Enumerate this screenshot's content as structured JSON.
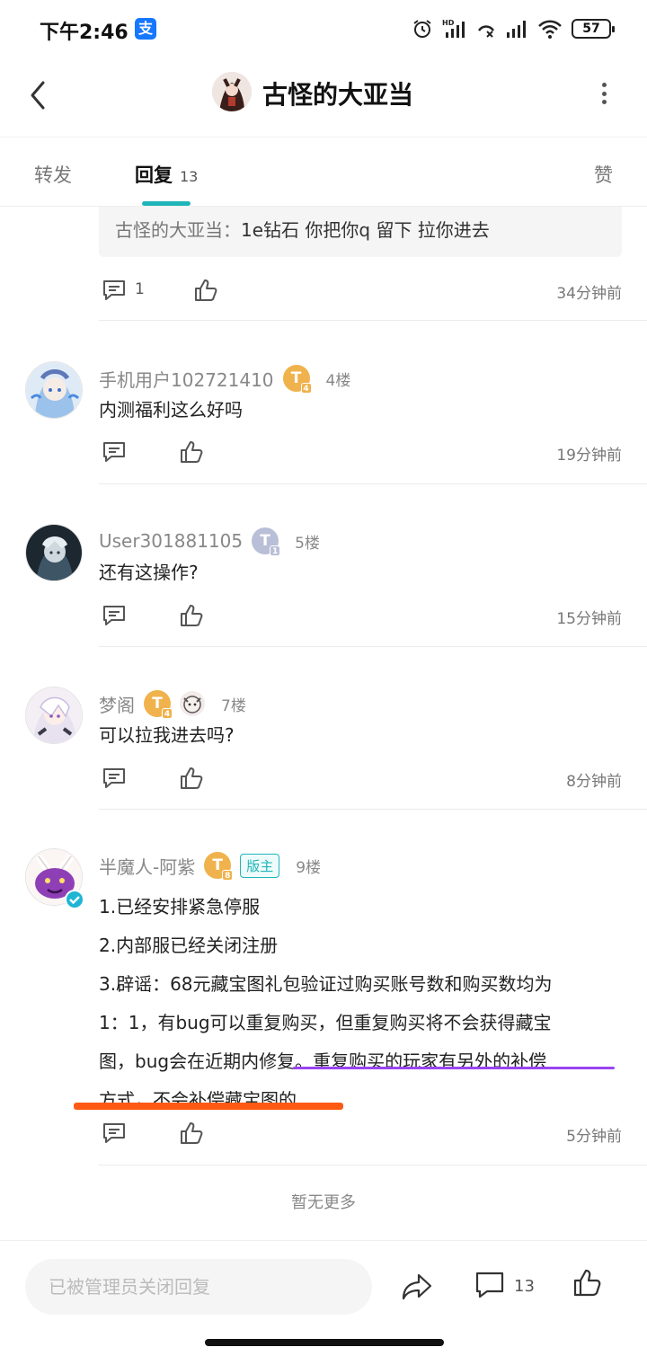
{
  "status_bar": {
    "time": "下午2:46",
    "app_icon": "支",
    "battery": "57",
    "icons": [
      "alarm-icon",
      "hd-signal-icon",
      "no-call-icon",
      "signal-icon",
      "wifi-icon",
      "battery-icon"
    ]
  },
  "header": {
    "title": "古怪的大亚当",
    "back_icon": "chevron-left-icon",
    "more_icon": "vertical-dots-icon"
  },
  "tabs": {
    "repost": "转发",
    "reply": "回复",
    "reply_count": "13",
    "like": "赞",
    "accent": "#1fb5b9"
  },
  "quoted": {
    "author": "古怪的大亚当：",
    "text": "1e钻石 你把你q 留下 拉你进去",
    "comment_count": "1",
    "time": "34分钟前"
  },
  "comments": [
    {
      "name": "手机用户102721410",
      "level": "T",
      "level_num": "4",
      "floor": "4楼",
      "text": "内测福利这么好吗",
      "time": "19分钟前"
    },
    {
      "name": "User301881105",
      "level": "T",
      "level_num": "1",
      "floor": "5楼",
      "text": "还有这操作?",
      "time": "15分钟前"
    },
    {
      "name": "梦阁",
      "level": "T",
      "level_num": "4",
      "floor": "7楼",
      "text": "可以拉我进去吗?",
      "time": "8分钟前"
    },
    {
      "name": "半魔人-阿紫",
      "level": "T",
      "level_num": "8",
      "badge": "版主",
      "floor": "9楼",
      "lines": [
        "1.已经安排紧急停服",
        "2.内部服已经关闭注册",
        "3.辟谣：68元藏宝图礼包验证过购买账号数和购买数均为",
        "1：1，有bug可以重复购买，但重复购买将不会获得藏宝",
        "图，bug会在近期内修复。重复购买的玩家有另外的补偿",
        "方式，不会补偿藏宝图的"
      ],
      "time": "5分钟前"
    }
  ],
  "no_more": "暂无更多",
  "bottom_bar": {
    "placeholder": "已被管理员关闭回复",
    "comment_count": "13"
  },
  "colors": {
    "highlight_purple": "#9b44f1",
    "highlight_orange": "#ff5a13",
    "level_gold": "#f0b24c",
    "level_silver": "#b8bfd6"
  }
}
